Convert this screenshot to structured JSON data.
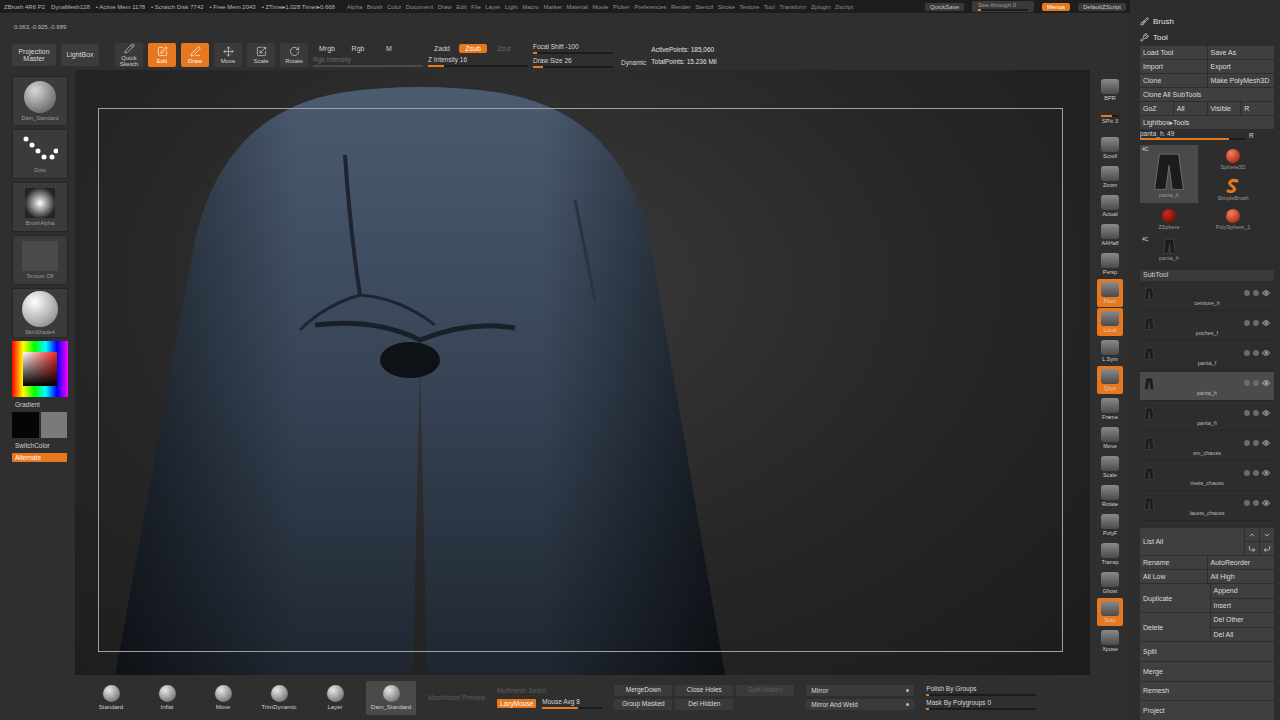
{
  "app": {
    "title": "ZBrush 4R6 P2",
    "status": [
      "DynaMesh128",
      "• Active Mem 1178",
      "• Scratch Disk 7742",
      "• Free Mem 2043",
      "• ZTime▸1.028 Timer▸0.668"
    ]
  },
  "menus": [
    "Alpha",
    "Brush",
    "Color",
    "Document",
    "Draw",
    "Edit",
    "File",
    "Layer",
    "Light",
    "Macro",
    "Marker",
    "Material",
    "Movie",
    "Picker",
    "Preferences",
    "Render",
    "Stencil",
    "Stroke",
    "Texture",
    "Tool",
    "Transform",
    "Zplugin",
    "Zscript"
  ],
  "top_right": {
    "quicksave": "QuickSave",
    "see_through": {
      "label": "See-through 0",
      "level": 0
    },
    "menus": {
      "label": "Menus",
      "on": true
    },
    "script": "DefaultZScript"
  },
  "coords": "0.063,-0.925,-0.989",
  "toolbar": {
    "left": [
      "Projection Master",
      "LightBox"
    ],
    "modes": [
      {
        "label": "Quick Sketch",
        "selected": false
      },
      {
        "label": "Edit",
        "selected": true
      },
      {
        "label": "Draw",
        "selected": true
      },
      {
        "label": "Move",
        "selected": false
      },
      {
        "label": "Scale",
        "selected": false
      },
      {
        "label": "Rotate",
        "selected": false
      }
    ],
    "color_modes": [
      {
        "label": "Mrgb",
        "selected": false
      },
      {
        "label": "Rgb",
        "selected": false
      },
      {
        "label": "M",
        "selected": false
      }
    ],
    "rgb_intensity": {
      "label": "Rgb Intensity",
      "disabled": true,
      "level": 1
    },
    "z_modes": [
      {
        "label": "Zadd",
        "selected": false,
        "disabled": false
      },
      {
        "label": "Zsub",
        "selected": true,
        "disabled": false
      },
      {
        "label": "Zcut",
        "selected": false,
        "disabled": true
      }
    ],
    "z_intensity": {
      "label": "Z Intensity 16",
      "level": 0.16
    },
    "focal_shift": {
      "label": "Focal Shift -100",
      "level": 0.05
    },
    "draw_size": {
      "label": "Draw Size 26",
      "level": 0.12
    },
    "dynamic": "Dynamic",
    "active_points": "ActivePoints: 185,060",
    "total_points": "TotalPoints: 15.236 Mil"
  },
  "left_shelf": {
    "thumbs": [
      {
        "label": "Dam_Standard",
        "kind": "brush"
      },
      {
        "label": "Dots",
        "kind": "stroke"
      },
      {
        "label": "BrushAlpha",
        "kind": "alpha"
      },
      {
        "label": "Texture Off",
        "kind": "texture"
      },
      {
        "label": "SkinShade4",
        "kind": "material"
      }
    ],
    "gradient": "Gradient",
    "switch_color": "SwitchColor",
    "alternate": {
      "label": "Alternate",
      "on": true
    }
  },
  "right_shelf": [
    {
      "label": "BPR",
      "kind": "button",
      "on": false,
      "level": 0
    },
    {
      "label": "SPix 3",
      "kind": "slider",
      "on": false,
      "level": 0.6
    },
    {
      "label": "Scroll",
      "kind": "button",
      "on": false,
      "level": 0
    },
    {
      "label": "Zoom",
      "kind": "button",
      "on": false,
      "level": 0
    },
    {
      "label": "Actual",
      "kind": "button",
      "on": false,
      "level": 0
    },
    {
      "label": "AAHalf",
      "kind": "button",
      "on": false,
      "level": 0
    },
    {
      "label": "Persp",
      "kind": "button",
      "on": false,
      "level": 0
    },
    {
      "label": "Floor",
      "kind": "button",
      "on": true,
      "level": 0
    },
    {
      "label": "Local",
      "kind": "button",
      "on": true,
      "level": 0
    },
    {
      "label": "L.Sym",
      "kind": "button",
      "on": false,
      "level": 0
    },
    {
      "label": "Qxyz",
      "kind": "button",
      "on": true,
      "level": 0
    },
    {
      "label": "Frame",
      "kind": "button",
      "on": false,
      "level": 0
    },
    {
      "label": "Move",
      "kind": "button",
      "on": false,
      "level": 0
    },
    {
      "label": "Scale",
      "kind": "button",
      "on": false,
      "level": 0
    },
    {
      "label": "Rotate",
      "kind": "button",
      "on": false,
      "level": 0
    },
    {
      "label": "PolyF",
      "kind": "button",
      "on": false,
      "level": 0
    },
    {
      "label": "Transp",
      "kind": "button",
      "on": false,
      "level": 0
    },
    {
      "label": "Ghost",
      "kind": "button",
      "on": false,
      "level": 0
    },
    {
      "label": "Solo",
      "kind": "button",
      "on": true,
      "level": 0
    },
    {
      "label": "Xpose",
      "kind": "button",
      "on": false,
      "level": 0
    }
  ],
  "bottom_bar": {
    "brushes": [
      {
        "label": "Standard",
        "selected": false
      },
      {
        "label": "Inflat",
        "selected": false
      },
      {
        "label": "Move",
        "selected": false
      },
      {
        "label": "TrimDynamic",
        "selected": false
      },
      {
        "label": "Layer",
        "selected": false
      },
      {
        "label": "Dam_Standard",
        "selected": true
      }
    ],
    "mesh_insert": {
      "label": "MeshInsert Preview",
      "disabled": true
    },
    "multimesh": {
      "label": "Multimesh Select",
      "disabled": true
    },
    "lazymouse": {
      "label": "LazyMouse",
      "on": true
    },
    "mouse_avg": {
      "label": "Mouse Avg 8",
      "level": 0.6
    },
    "buttons": [
      {
        "label": "MergeDown",
        "disabled": false
      },
      {
        "label": "Close Holes",
        "disabled": false
      },
      {
        "label": "Split Hidden",
        "disabled": true
      },
      {
        "label": "Group Masked",
        "disabled": false
      },
      {
        "label": "Del Hidden",
        "disabled": false
      }
    ],
    "mirror": [
      "Mirror",
      "Mirror And Weld"
    ],
    "polish": {
      "label": "Polish By Groups",
      "level": 0
    },
    "mask_groups": {
      "label": "Mask By Polygroups 0",
      "level": 0
    }
  },
  "right_panel": {
    "brush_header": "Brush",
    "tool_header": "Tool",
    "button_rows": [
      [
        "Load Tool",
        "Save As"
      ],
      [
        "Import",
        "Export"
      ],
      [
        "Clone",
        "Make PolyMesh3D"
      ],
      [
        "Clone All SubTools"
      ],
      [
        "GoZ",
        "All",
        "Visible",
        "R"
      ],
      [
        "Lightbox▸Tools"
      ]
    ],
    "tool_slider": {
      "label": "panta_h. 49",
      "level": 0.85,
      "reset": "R"
    },
    "thumbs": [
      {
        "label": "panta_h",
        "kind": "mesh",
        "selected": true,
        "badge": "4C"
      },
      {
        "label": "Sphere3D",
        "kind": "sphere",
        "selected": false,
        "badge": ""
      },
      {
        "label": "SimpleBrush",
        "kind": "brush",
        "selected": false,
        "badge": ""
      },
      {
        "label": "ZSphere",
        "kind": "zsphere",
        "selected": false,
        "badge": ""
      },
      {
        "label": "PolySphere_1",
        "kind": "sphere",
        "selected": false,
        "badge": ""
      },
      {
        "label": "panta_h",
        "kind": "mesh",
        "selected": false,
        "badge": "4C"
      }
    ],
    "subtool": {
      "title": "SubTool",
      "items": [
        {
          "label": "ceinture_h",
          "selected": false,
          "visible": true
        },
        {
          "label": "poches_f",
          "selected": false,
          "visible": true
        },
        {
          "label": "panta_f",
          "selected": false,
          "visible": true
        },
        {
          "label": "panta_h",
          "selected": true,
          "visible": true
        },
        {
          "label": "panta_h",
          "selected": false,
          "visible": true
        },
        {
          "label": "sm_chauss",
          "selected": false,
          "visible": true
        },
        {
          "label": "rivets_chauss",
          "selected": false,
          "visible": true
        },
        {
          "label": "lacets_chauss",
          "selected": false,
          "visible": true
        }
      ]
    },
    "list_all": "List All",
    "pairs": [
      [
        "Rename",
        "AutoReorder"
      ],
      [
        "All Low",
        "All High"
      ]
    ],
    "groups": [
      {
        "main": "Duplicate",
        "side": [
          "Append",
          "Insert"
        ]
      },
      {
        "main": "Delete",
        "side": [
          "Del Other",
          "Del All"
        ]
      }
    ],
    "singles": [
      "Split",
      "Merge",
      "Remesh",
      "Project"
    ]
  }
}
